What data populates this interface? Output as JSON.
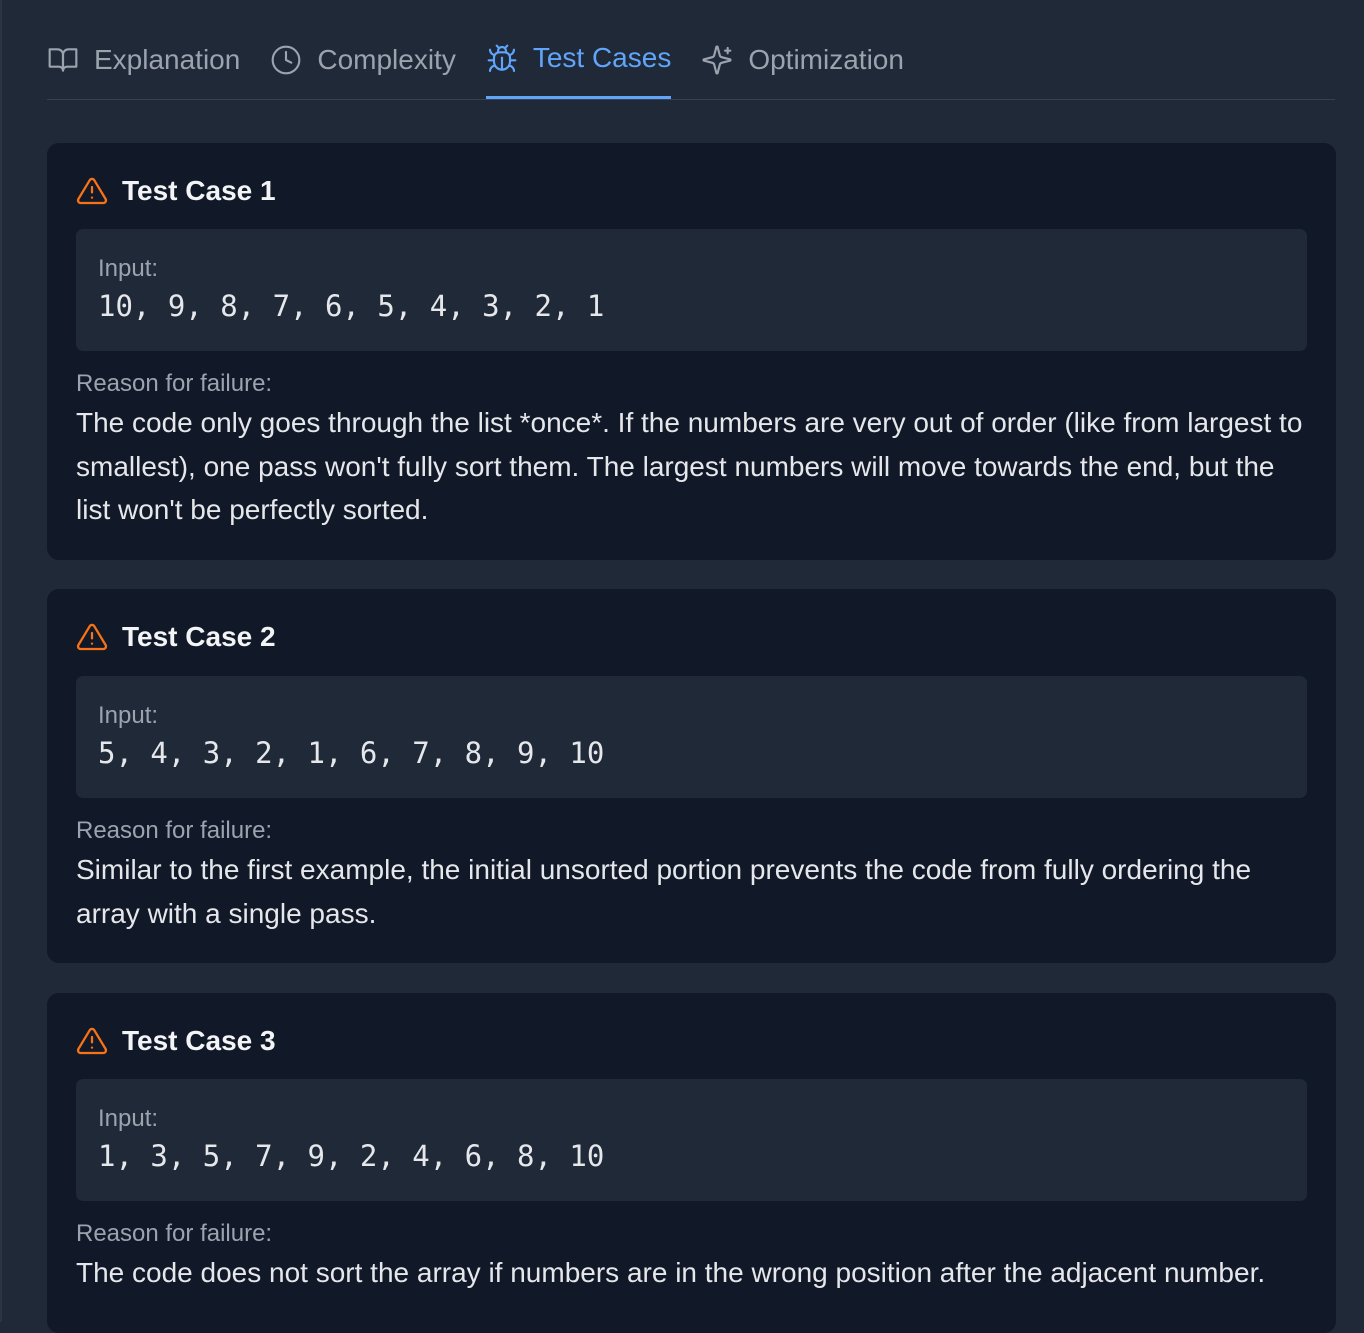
{
  "tabs": [
    {
      "label": "Explanation",
      "icon": "book-open-icon",
      "active": false
    },
    {
      "label": "Complexity",
      "icon": "clock-icon",
      "active": false
    },
    {
      "label": "Test Cases",
      "icon": "bug-icon",
      "active": true
    },
    {
      "label": "Optimization",
      "icon": "sparkles-icon",
      "active": false
    }
  ],
  "colors": {
    "active_tab": "#60a5fa",
    "warning_icon": "#f97316",
    "card_bg": "#111827",
    "panel_bg": "#1f2937"
  },
  "input_label": "Input:",
  "reason_label": "Reason for failure:",
  "test_cases": [
    {
      "title": "Test Case 1",
      "input": "10, 9, 8, 7, 6, 5, 4, 3, 2, 1",
      "reason": "The code only goes through the list *once*. If the numbers are very out of order (like from largest to smallest), one pass won't fully sort them. The largest numbers will move towards the end, but the list won't be perfectly sorted."
    },
    {
      "title": "Test Case 2",
      "input": "5, 4, 3, 2, 1, 6, 7, 8, 9, 10",
      "reason": "Similar to the first example, the initial unsorted portion prevents the code from fully ordering the array with a single pass."
    },
    {
      "title": "Test Case 3",
      "input": "1, 3, 5, 7, 9, 2, 4, 6, 8, 10",
      "reason": "The code does not sort the array if numbers are in the wrong position after the adjacent number."
    }
  ]
}
